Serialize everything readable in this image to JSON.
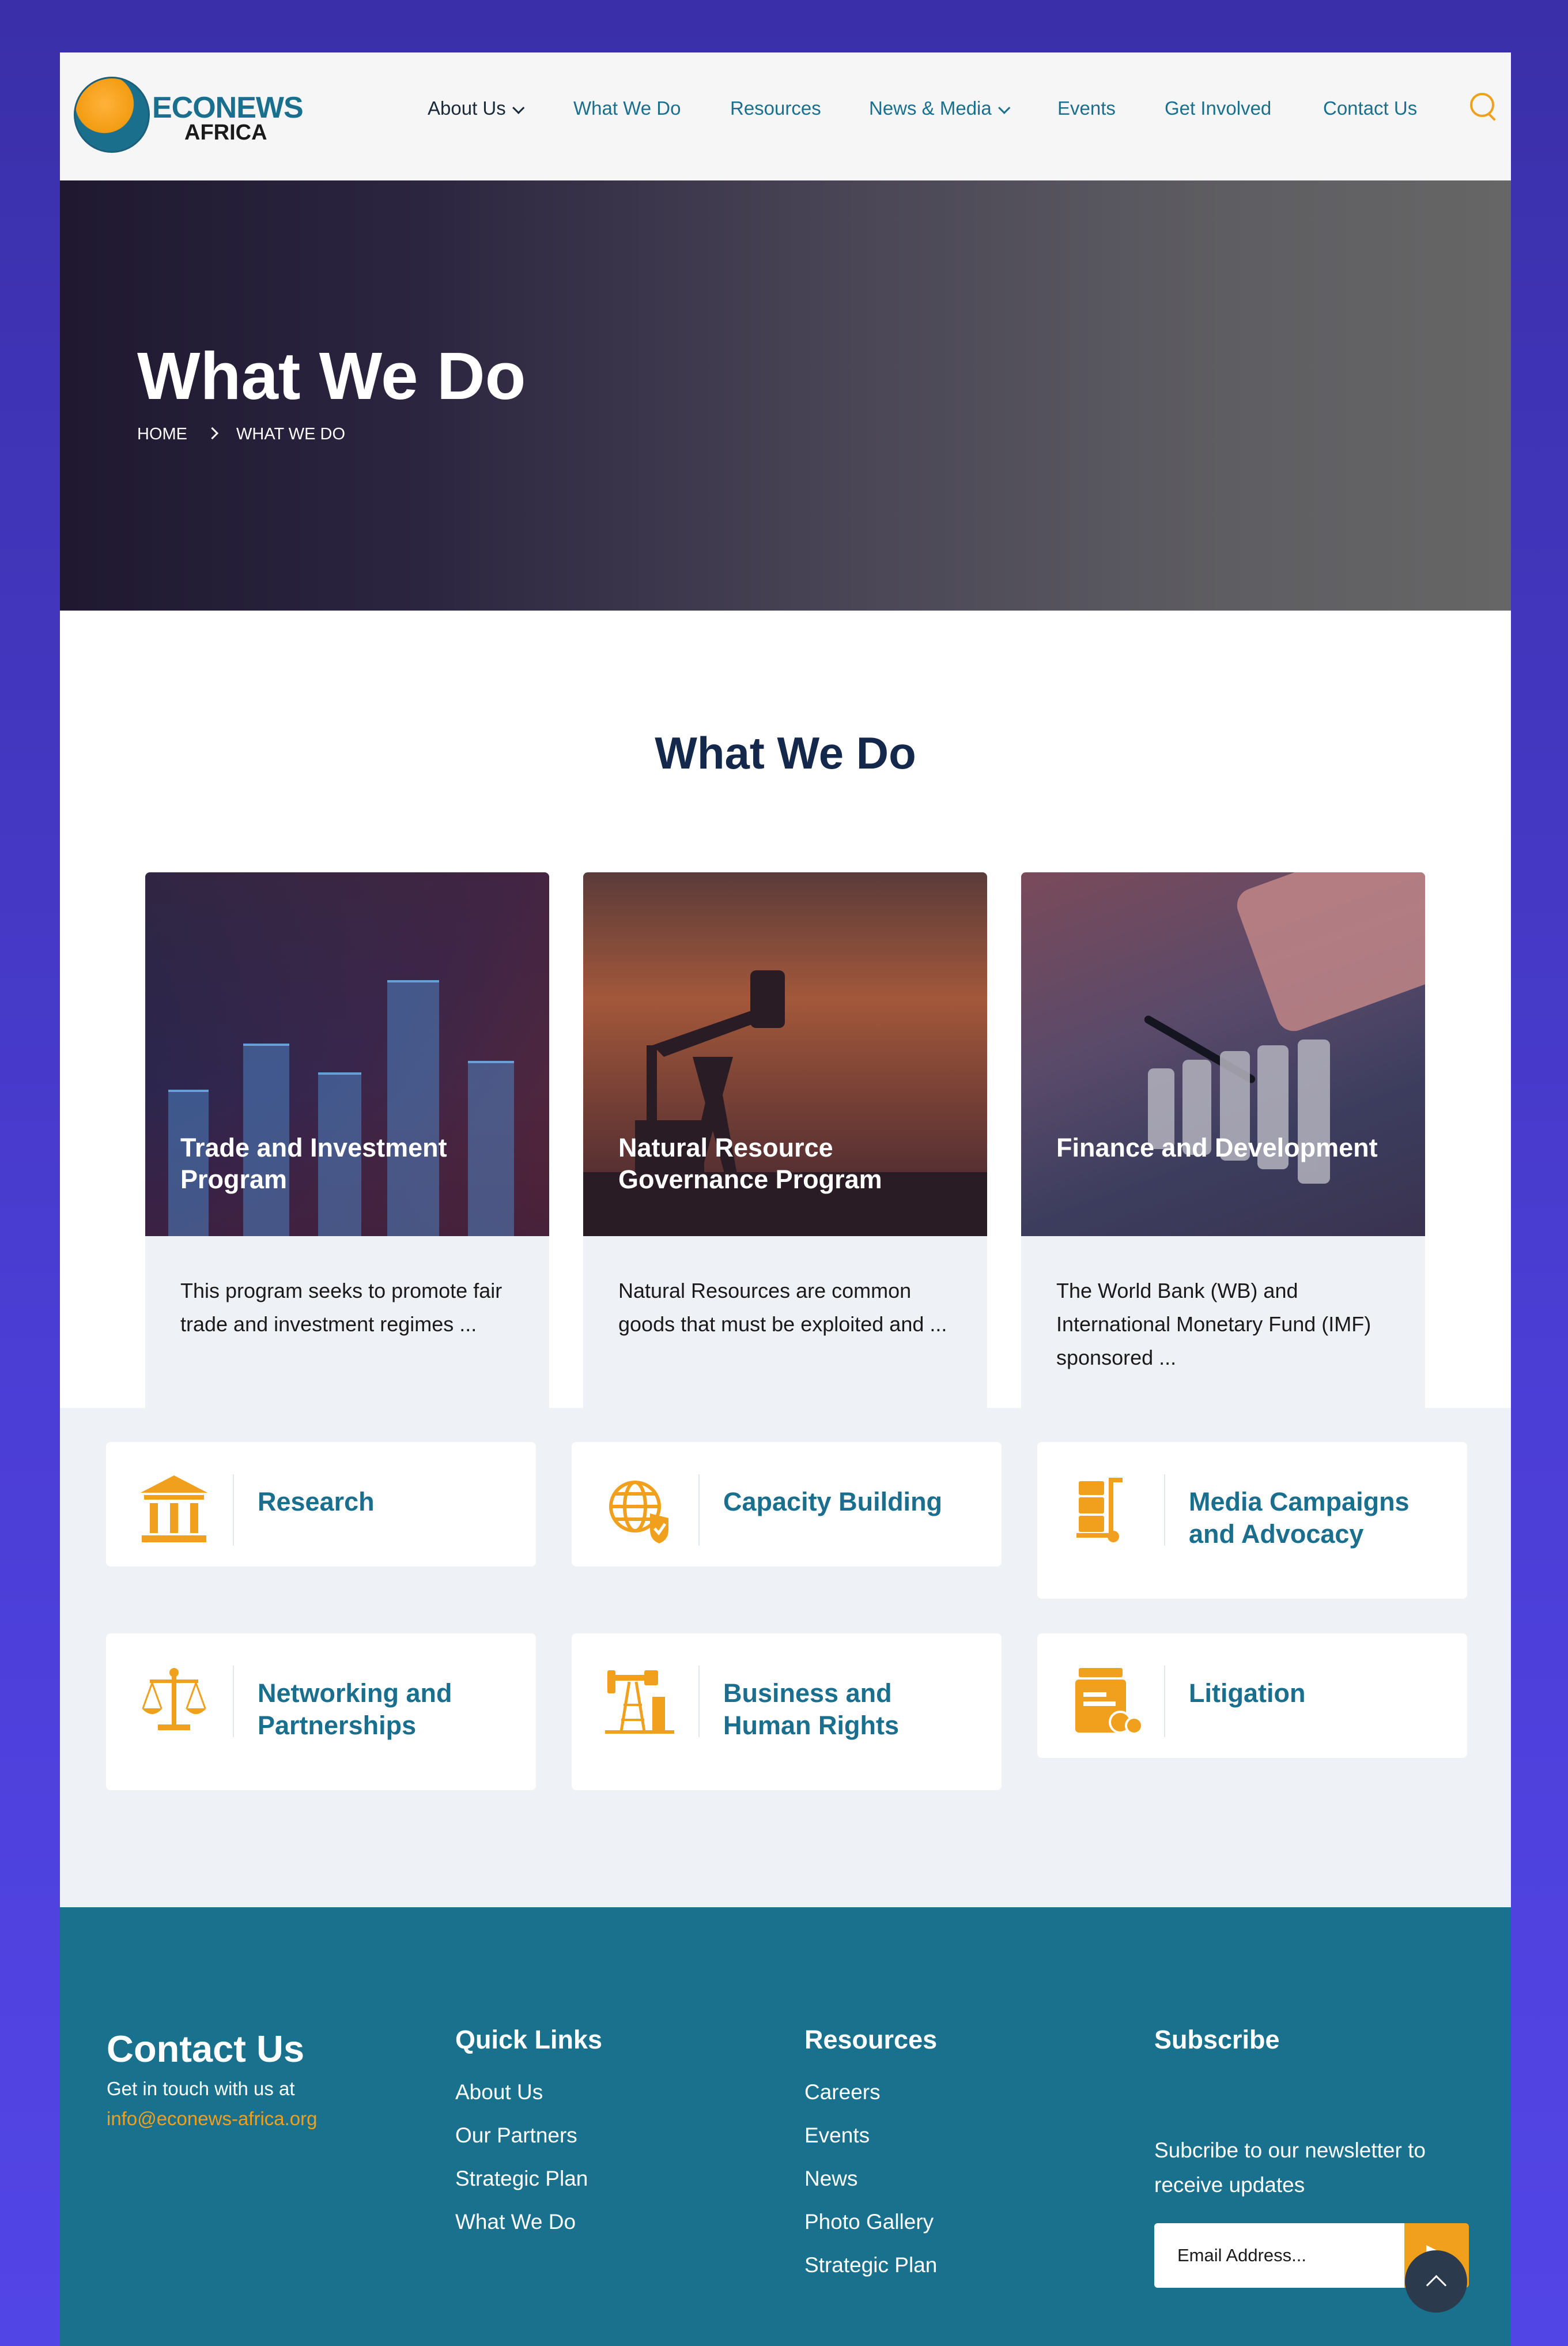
{
  "brand": {
    "name": "ECONEWS",
    "sub": "AFRICA"
  },
  "nav": [
    {
      "label": "About Us",
      "has_dropdown": true
    },
    {
      "label": "What We Do",
      "has_dropdown": false
    },
    {
      "label": "Resources",
      "has_dropdown": false
    },
    {
      "label": "News & Media",
      "has_dropdown": true
    },
    {
      "label": "Events",
      "has_dropdown": false
    },
    {
      "label": "Get Involved",
      "has_dropdown": false
    },
    {
      "label": "Contact Us",
      "has_dropdown": false
    }
  ],
  "hero": {
    "title": "What We Do",
    "breadcrumb": [
      "HOME",
      "WHAT WE DO"
    ]
  },
  "section": {
    "title": "What We Do"
  },
  "programs": [
    {
      "title": "Trade and Investment Program",
      "text": "This program seeks to promote fair trade and investment regimes ..."
    },
    {
      "title": "Natural Resource Governance Program",
      "text": "Natural Resources are common goods that must be exploited and ..."
    },
    {
      "title": "Finance and Development",
      "text": "The World Bank (WB) and International Monetary Fund (IMF) sponsored ..."
    }
  ],
  "services": [
    {
      "label": "Research",
      "icon": "building-columns-icon"
    },
    {
      "label": "Capacity Building",
      "icon": "globe-shield-icon"
    },
    {
      "label": "Media Campaigns and Advocacy",
      "icon": "hand-truck-icon"
    },
    {
      "label": "Networking and Partnerships",
      "icon": "scales-icon"
    },
    {
      "label": "Business and Human Rights",
      "icon": "oil-pump-icon"
    },
    {
      "label": "Litigation",
      "icon": "medicine-jar-icon"
    }
  ],
  "footer": {
    "contact": {
      "title": "Contact Us",
      "text": "Get in touch with us at",
      "email": "info@econews-africa.org"
    },
    "quick_links": {
      "title": "Quick Links",
      "items": [
        "About Us",
        "Our Partners",
        "Strategic Plan",
        "What We Do"
      ]
    },
    "resources": {
      "title": "Resources",
      "items": [
        "Careers",
        "Events",
        "News",
        "Photo Gallery",
        "Strategic Plan"
      ]
    },
    "subscribe": {
      "title": "Subscribe",
      "text": "Subcribe to our newsletter to receive updates",
      "placeholder": "Email Address..."
    }
  },
  "colors": {
    "accent": "#f0a01c",
    "teal": "#1b6f8e",
    "navy": "#14284b",
    "footer_bg": "#19718e"
  }
}
